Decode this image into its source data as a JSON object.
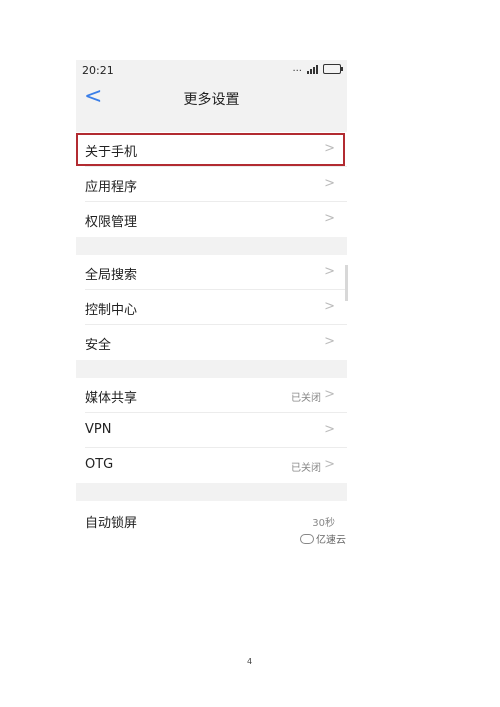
{
  "status_bar": {
    "time": "20:21",
    "dots": "..."
  },
  "nav": {
    "title": "更多设置",
    "back": "<"
  },
  "rows": [
    {
      "label": "关于手机",
      "value": "",
      "chevron": ">"
    },
    {
      "label": "应用程序",
      "value": "",
      "chevron": ">"
    },
    {
      "label": "权限管理",
      "value": "",
      "chevron": ">"
    },
    {
      "label": "全局搜索",
      "value": "",
      "chevron": ">"
    },
    {
      "label": "控制中心",
      "value": "",
      "chevron": ">"
    },
    {
      "label": "安全",
      "value": "",
      "chevron": ">"
    },
    {
      "label": "媒体共享",
      "value": "已关闭",
      "chevron": ">"
    },
    {
      "label": "VPN",
      "value": "",
      "chevron": ">"
    },
    {
      "label": "OTG",
      "value": "已关闭",
      "chevron": ">"
    },
    {
      "label": "自动锁屏",
      "value": "30秒",
      "chevron": ""
    }
  ],
  "watermark": "亿速云",
  "page_number": "4",
  "colors": {
    "highlight": "#b22b31",
    "accent": "#3a7ee8",
    "gap": "#f2f2f2"
  }
}
